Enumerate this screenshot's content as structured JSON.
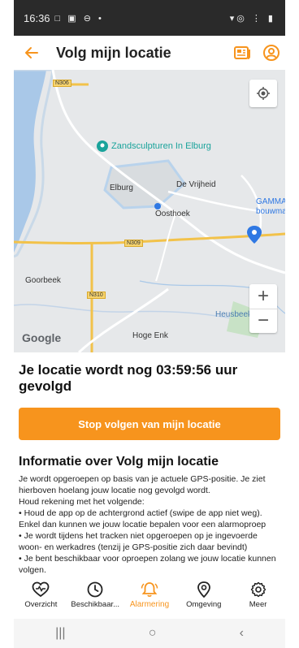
{
  "status_bar": {
    "time": "16:36",
    "left_icons": "□ ▣ ⊖ •",
    "right_icons": "▾◎ ⋮ ▮"
  },
  "app_bar": {
    "title": "Volg mijn locatie"
  },
  "map": {
    "labels": {
      "poi": "Zandsculpturen In Elburg",
      "elburg": "Elburg",
      "vrijheid": "De Vrijheid",
      "gamma1": "GAMMA",
      "gamma2": "bouwmar",
      "oosthoek": "Oosthoek",
      "goorbeek": "Goorbeek",
      "heusbeek": "Heusbeek",
      "hoge_enk": "Hoge Enk"
    },
    "roads": {
      "n306": "N306",
      "n309": "N309",
      "n310": "N310"
    },
    "google": "Google",
    "zoom_in": "+",
    "zoom_out": "−"
  },
  "tracking_text": "Je locatie wordt nog 03:59:56 uur gevolgd",
  "stop_button": "Stop volgen van mijn locatie",
  "info": {
    "title": "Informatie over Volg mijn locatie",
    "p1": "Je wordt opgeroepen op basis van je actuele GPS-positie. Je ziet hierboven hoelang jouw locatie nog gevolgd wordt.",
    "p2": "Houd rekening met het volgende:",
    "b1": "• Houd de app op de achtergrond actief (swipe de app niet weg). Enkel dan kunnen we jouw locatie bepalen voor een alarmoproep",
    "b2": "• Je wordt tijdens het tracken niet opgeroepen op je ingevoerde woon- en werkadres (tenzij je GPS-positie zich daar bevindt)",
    "b3": "• Je bent beschikbaar voor oproepen zolang we jouw locatie kunnen volgen."
  },
  "bottom_nav": [
    {
      "label": "Overzicht",
      "icon": "heart-pulse-icon"
    },
    {
      "label": "Beschikbaar...",
      "icon": "clock-icon"
    },
    {
      "label": "Alarmering",
      "icon": "bell-alarm-icon",
      "active": true
    },
    {
      "label": "Omgeving",
      "icon": "location-pin-icon"
    },
    {
      "label": "Meer",
      "icon": "gear-icon"
    }
  ],
  "system_nav": {
    "recents": "|||",
    "home": "○",
    "back": "‹"
  },
  "colors": {
    "accent": "#f7941d",
    "status_bar": "#2a2a2a",
    "water": "#a9c8e8",
    "map_land": "#e6e8ea"
  }
}
